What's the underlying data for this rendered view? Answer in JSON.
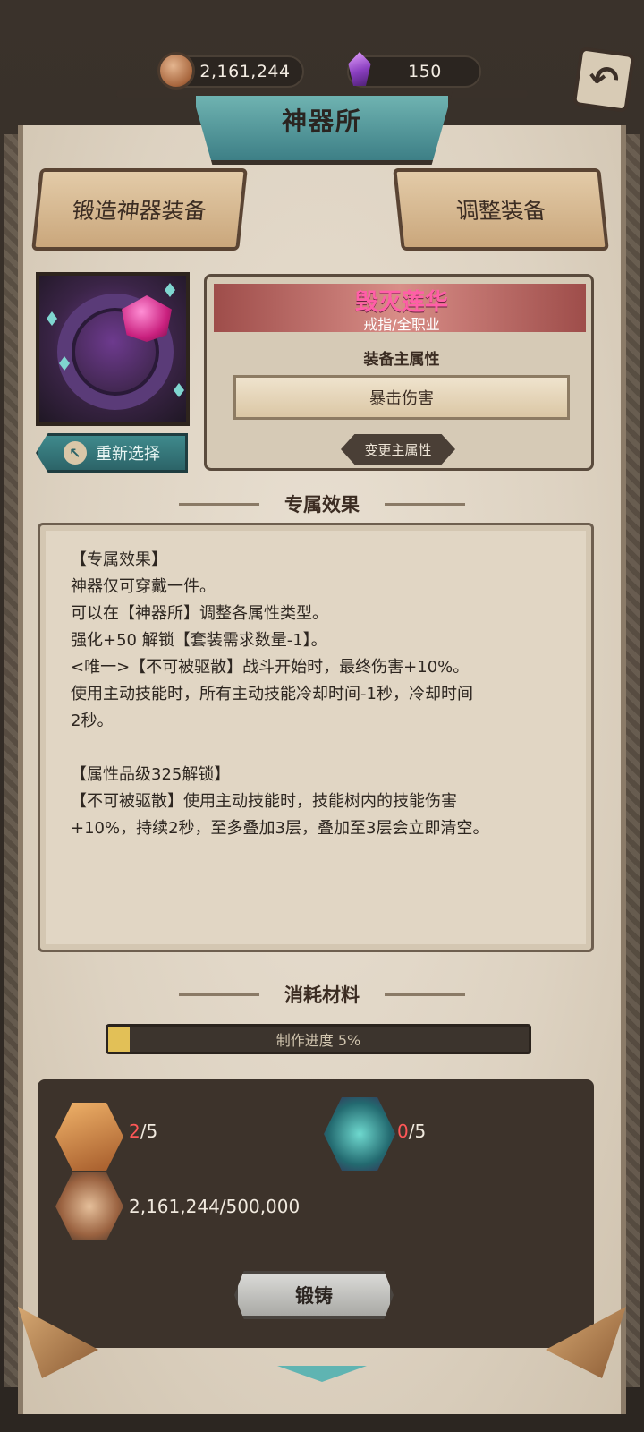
{
  "currency": {
    "coins": "2,161,244",
    "gems": "150",
    "coin_icon": "copper-coin-icon",
    "gem_icon": "purple-crystal-icon"
  },
  "header": {
    "title": "神器所",
    "back_icon": "return-arrow-icon"
  },
  "tabs": [
    {
      "label": "锻造神器装备"
    },
    {
      "label": "调整装备"
    }
  ],
  "artifact": {
    "name": "毁灭莲华",
    "type": "戒指/全职业",
    "reselect_label": "重新选择",
    "main_attr_label": "装备主属性",
    "main_attr_value": "暴击伤害",
    "change_attr_label": "变更主属性"
  },
  "effects": {
    "title": "专属效果",
    "lines": [
      "【专属效果】",
      "神器仅可穿戴一件。",
      "可以在【神器所】调整各属性类型。",
      "强化+50 解锁【套装需求数量-1】。",
      "<唯一>【不可被驱散】战斗开始时，最终伤害+10%。",
      "使用主动技能时，所有主动技能冷却时间-1秒，冷却时间",
      "2秒。",
      "",
      "【属性品级325解锁】",
      "【不可被驱散】使用主动技能时，技能树内的技能伤害",
      "+10%，持续2秒，至多叠加3层，叠加至3层会立即清空。"
    ]
  },
  "materials": {
    "title": "消耗材料",
    "progress_label": "制作进度  5%",
    "progress_fraction": 0.05,
    "items": [
      {
        "icon": "copper-ingot-icon",
        "have": "2",
        "need": "/5"
      },
      {
        "icon": "cyan-crystal-icon",
        "have": "0",
        "need": "/5"
      },
      {
        "icon": "copper-coin-icon",
        "text": "2,161,244/500,000"
      }
    ],
    "forge_label": "锻铸"
  },
  "colors": {
    "accent_teal": "#3d7f86",
    "name_pink": "#ff5fa7",
    "lack_red": "#ff5757",
    "progress_gold": "#e2c057"
  }
}
